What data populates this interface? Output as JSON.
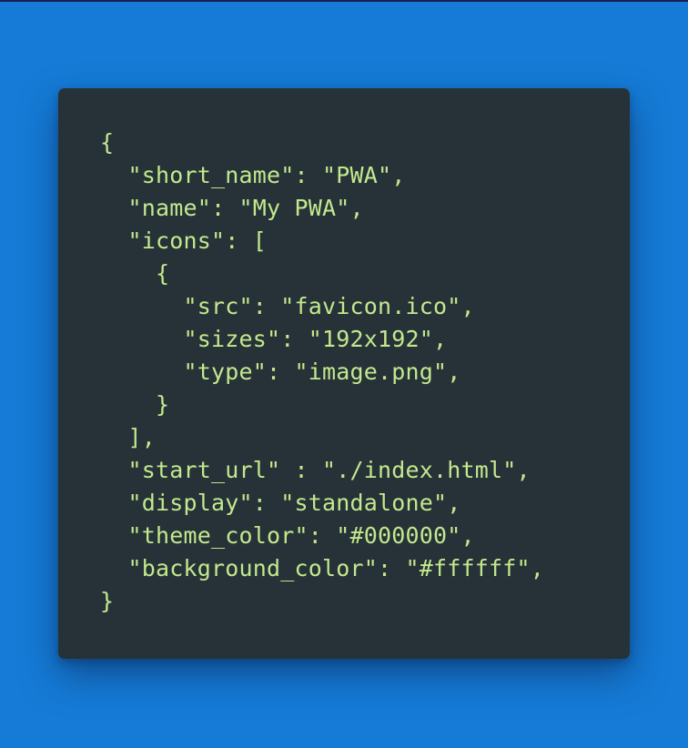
{
  "colors": {
    "background": "#157bd6",
    "card": "#263238",
    "code_text": "#c3e88d"
  },
  "code": {
    "lines": [
      "{",
      "  \"short_name\": \"PWA\",",
      "  \"name\": \"My PWA\",",
      "  \"icons\": [",
      "    {",
      "      \"src\": \"favicon.ico\",",
      "      \"sizes\": \"192x192\",",
      "      \"type\": \"image.png\",",
      "    }",
      "  ],",
      "  \"start_url\" : \"./index.html\",",
      "  \"display\": \"standalone\",",
      "  \"theme_color\": \"#000000\",",
      "  \"background_color\": \"#ffffff\",",
      "}"
    ]
  }
}
